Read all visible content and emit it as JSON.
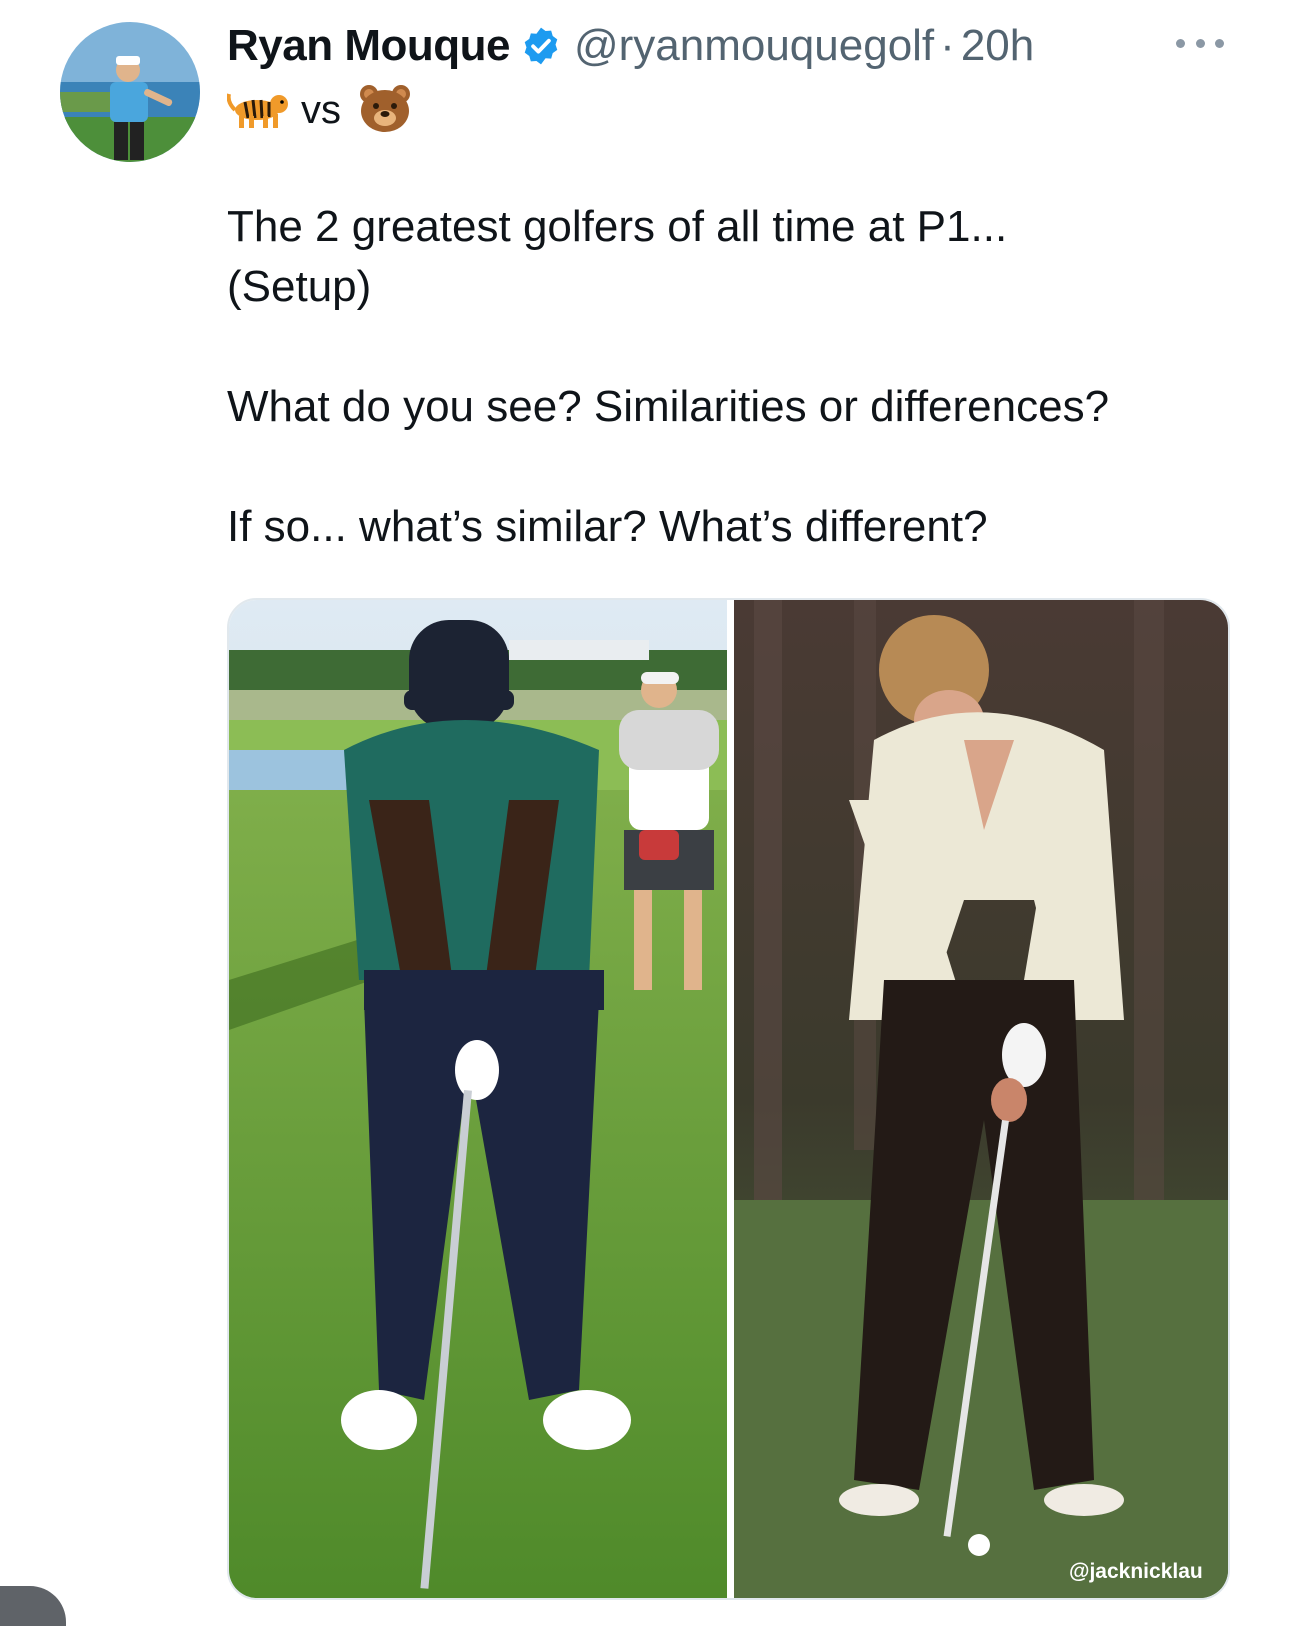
{
  "tweet": {
    "author": {
      "display_name": "Ryan Mouque",
      "handle": "@ryanmouquegolf",
      "separator": "·",
      "time": "20h",
      "verified": true,
      "verified_color": "#1d9bf0"
    },
    "emoji_line": {
      "left_emoji": "🐅",
      "vs_text": "vs",
      "right_emoji": "🐻"
    },
    "text_lines": [
      "The 2 greatest golfers of all time at P1...",
      "(Setup)",
      "What do you see? Similarities or differences?",
      "If so... what’s similar? What’s different?"
    ],
    "media": {
      "left_photo_icon": "golfer-setup-photo-modern",
      "right_photo_icon": "golfer-setup-photo-classic",
      "watermark": "@jacknicklau"
    },
    "more_icon": "more-options-icon"
  }
}
